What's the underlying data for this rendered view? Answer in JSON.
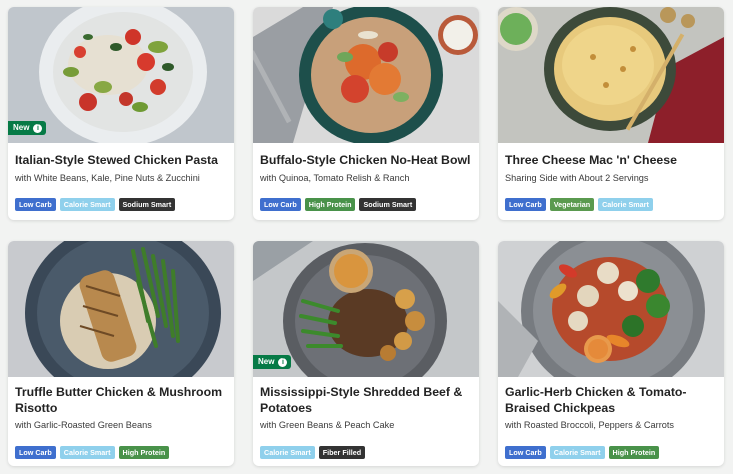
{
  "tag_colors": {
    "Low Carb": "#3f6fce",
    "Calorie Smart": "#8fd0ec",
    "Sodium Smart": "#333333",
    "High Protein": "#49924a",
    "Vegetarian": "#5a9a4f",
    "Fiber Filled": "#333333"
  },
  "new_badge_label": "New",
  "cards": [
    {
      "title": "Italian-Style Stewed Chicken Pasta",
      "subtitle": "with White Beans, Kale, Pine Nuts & Zucchini",
      "tags": [
        "Low Carb",
        "Calorie Smart",
        "Sodium Smart"
      ],
      "is_new": true
    },
    {
      "title": "Buffalo-Style Chicken No-Heat Bowl",
      "subtitle": "with Quinoa, Tomato Relish & Ranch",
      "tags": [
        "Low Carb",
        "High Protein",
        "Sodium Smart"
      ],
      "is_new": false
    },
    {
      "title": "Three Cheese Mac 'n' Cheese",
      "subtitle": "Sharing Side with About 2 Servings",
      "tags": [
        "Low Carb",
        "Vegetarian",
        "Calorie Smart"
      ],
      "is_new": false
    },
    {
      "title": "Truffle Butter Chicken & Mushroom Risotto",
      "subtitle": "with Garlic-Roasted Green Beans",
      "tags": [
        "Low Carb",
        "Calorie Smart",
        "High Protein"
      ],
      "is_new": false
    },
    {
      "title": "Mississippi-Style Shredded Beef & Potatoes",
      "subtitle": "with Green Beans & Peach Cake",
      "tags": [
        "Calorie Smart",
        "Fiber Filled"
      ],
      "is_new": true
    },
    {
      "title": "Garlic-Herb Chicken & Tomato-Braised Chickpeas",
      "subtitle": "with Roasted Broccoli, Peppers & Carrots",
      "tags": [
        "Low Carb",
        "Calorie Smart",
        "High Protein"
      ],
      "is_new": false
    }
  ]
}
